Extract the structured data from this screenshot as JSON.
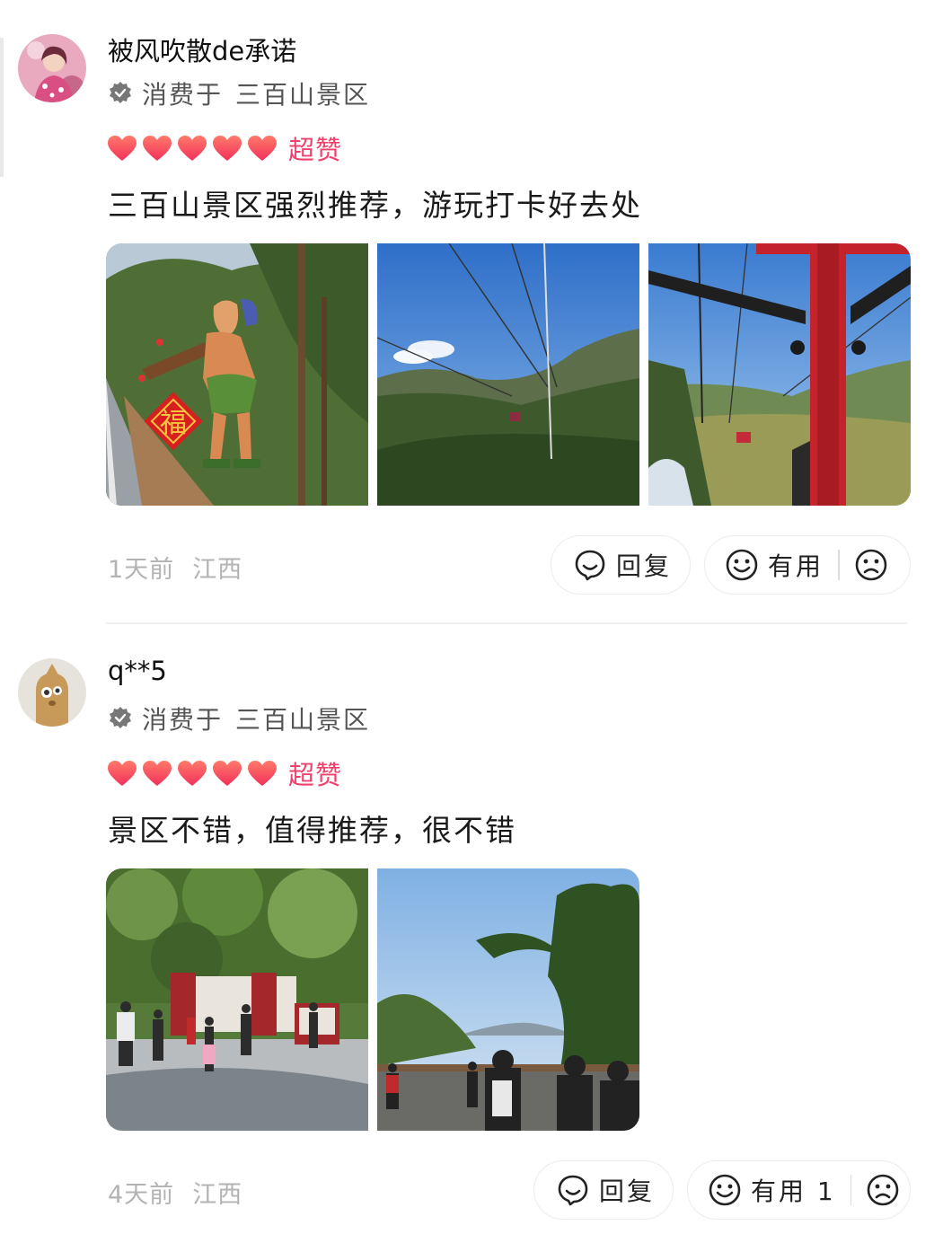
{
  "reviews": [
    {
      "username": "被风吹散de承诺",
      "consume_prefix": "消费于",
      "place": "三百山景区",
      "rating_label": "超赞",
      "hearts": 5,
      "text": "三百山景区强烈推荐，游玩打卡好去处",
      "time": "1天前",
      "location": "江西",
      "reply_label": "回复",
      "useful_label": "有用",
      "photo_count": 3
    },
    {
      "username": "q**5",
      "consume_prefix": "消费于",
      "place": "三百山景区",
      "rating_label": "超赞",
      "hearts": 5,
      "text": "景区不错，值得推荐，很不错",
      "time": "4天前",
      "location": "江西",
      "reply_label": "回复",
      "useful_label": "有用 1",
      "photo_count": 2
    }
  ],
  "signboard_char": "福",
  "colors": {
    "heart": "#f53e5e",
    "rating_label": "#f0416d",
    "meta": "#b3b3b3"
  },
  "icons": [
    "verified-icon",
    "heart-icon",
    "reply-icon",
    "smile-icon",
    "frown-icon"
  ]
}
